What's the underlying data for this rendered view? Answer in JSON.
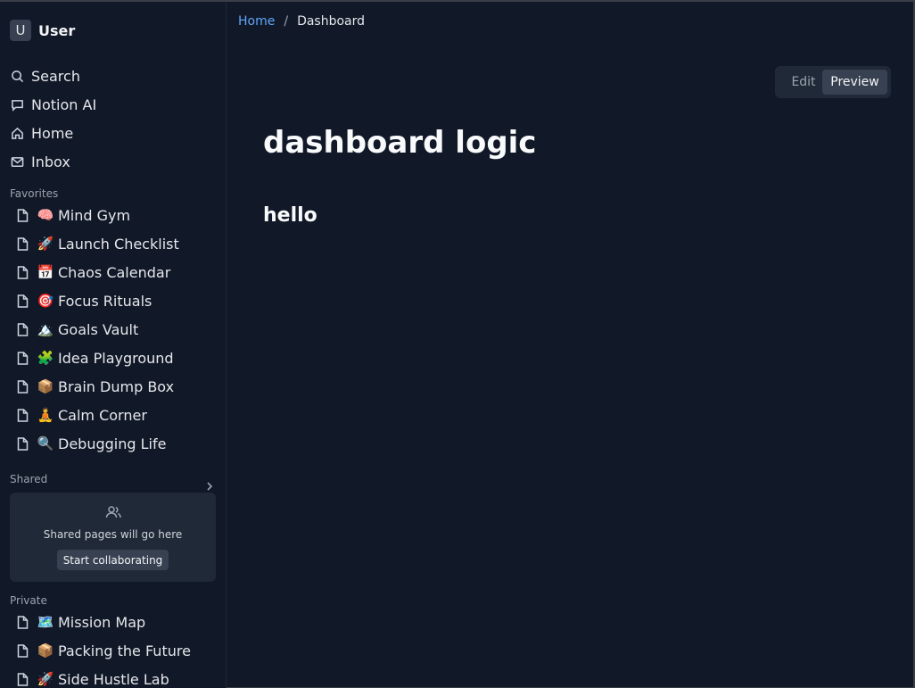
{
  "user": {
    "initial": "U",
    "name": "User"
  },
  "nav": [
    {
      "label": "Search",
      "icon": "search-icon"
    },
    {
      "label": "Notion AI",
      "icon": "chat-icon"
    },
    {
      "label": "Home",
      "icon": "home-icon"
    },
    {
      "label": "Inbox",
      "icon": "mail-icon"
    }
  ],
  "favorites": {
    "label": "Favorites",
    "items": [
      {
        "emoji": "🧠",
        "label": "Mind Gym"
      },
      {
        "emoji": "🚀",
        "label": "Launch Checklist"
      },
      {
        "emoji": "📅",
        "label": "Chaos Calendar"
      },
      {
        "emoji": "🎯",
        "label": "Focus Rituals"
      },
      {
        "emoji": "🏔️",
        "label": "Goals Vault"
      },
      {
        "emoji": "🧩",
        "label": "Idea Playground"
      },
      {
        "emoji": "📦",
        "label": "Brain Dump Box"
      },
      {
        "emoji": "🧘",
        "label": "Calm Corner"
      },
      {
        "emoji": "🔍",
        "label": "Debugging Life"
      }
    ]
  },
  "shared": {
    "label": "Shared",
    "empty_text": "Shared pages will go here",
    "button_label": "Start collaborating"
  },
  "private": {
    "label": "Private",
    "items": [
      {
        "emoji": "🗺️",
        "label": "Mission Map"
      },
      {
        "emoji": "📦",
        "label": "Packing the Future"
      },
      {
        "emoji": "🚀",
        "label": "Side Hustle Lab"
      }
    ]
  },
  "breadcrumb": {
    "home": "Home",
    "separator": "/",
    "current": "Dashboard"
  },
  "mode_toggle": {
    "edit": "Edit",
    "preview": "Preview",
    "active": "Preview"
  },
  "document": {
    "title": "dashboard logic",
    "heading": "hello"
  },
  "colors": {
    "background": "#111827",
    "panel": "#1f2937",
    "link": "#60a5fa"
  }
}
